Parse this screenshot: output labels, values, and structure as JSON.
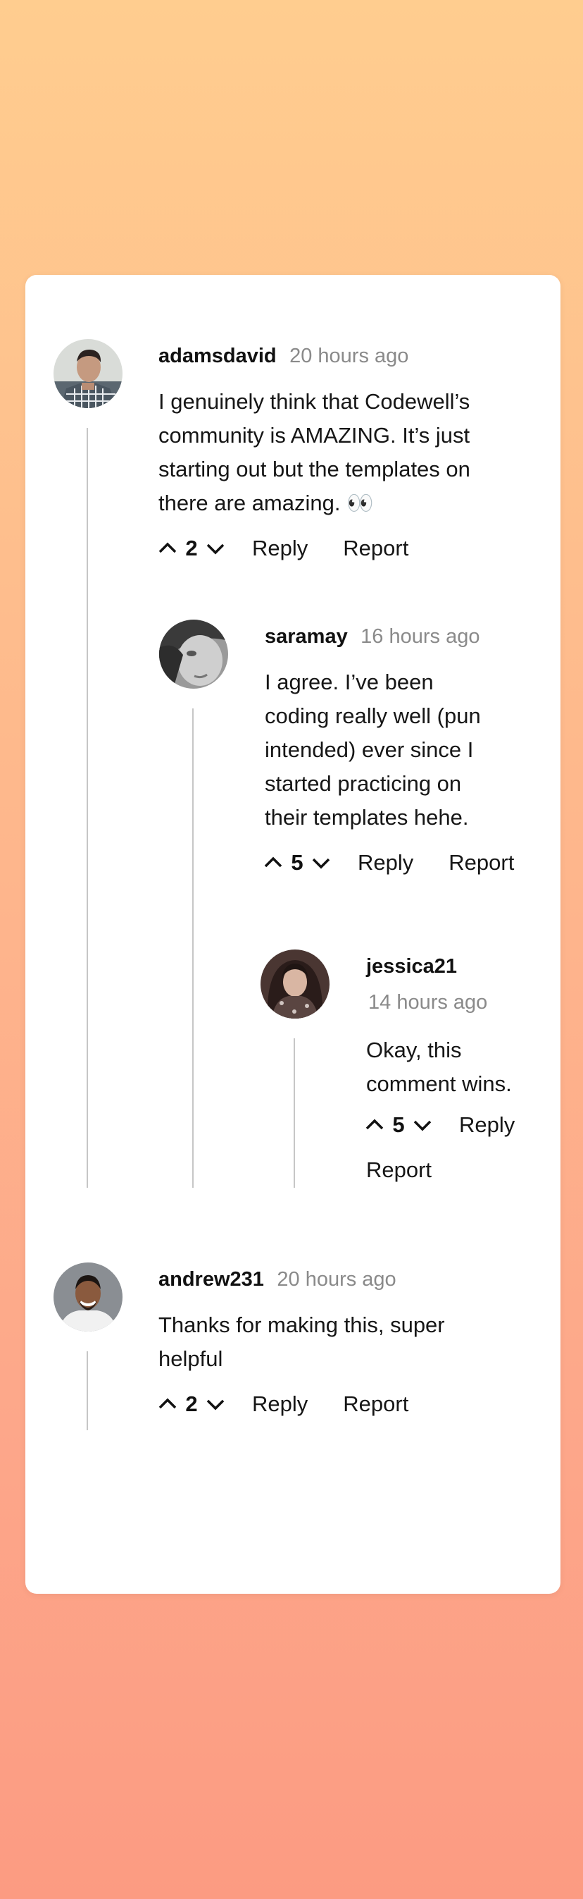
{
  "comments": [
    {
      "username": "adamsdavid",
      "time": "20 hours ago",
      "body": [
        "I genuinely think that Codewell’s",
        "community is AMAZING. It’s just",
        "starting out but the templates on",
        "there are amazing. 👀"
      ],
      "votes": "2",
      "reply_label": "Reply",
      "report_label": "Report",
      "replies": [
        {
          "username": "saramay",
          "time": "16 hours ago",
          "body": [
            "I agree. I’ve been",
            "coding really well (pun",
            "intended) ever since I",
            "started practicing on",
            "their templates hehe."
          ],
          "votes": "5",
          "reply_label": "Reply",
          "report_label": "Report",
          "replies": [
            {
              "username": "jessica21",
              "time": "14 hours ago",
              "body": [
                "Okay, this",
                "comment wins."
              ],
              "votes": "5",
              "reply_label": "Reply",
              "report_label": "Report"
            }
          ]
        }
      ]
    },
    {
      "username": "andrew231",
      "time": "20 hours ago",
      "body": [
        "Thanks for making this, super",
        "helpful"
      ],
      "votes": "2",
      "reply_label": "Reply",
      "report_label": "Report"
    }
  ],
  "colors": {
    "background_top": "#ffcd8f",
    "background_bottom": "#fc9b82",
    "card": "#ffffff",
    "thread_line": "#c6c6c6",
    "time_text": "#8a8a8a"
  }
}
